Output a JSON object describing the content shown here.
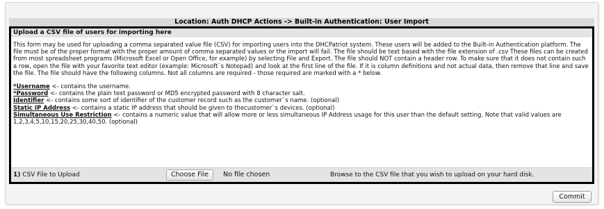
{
  "location_title": "Location: Auth DHCP Actions -> Built-in Authentication: User Import",
  "panel": {
    "header": "Upload a CSV file of users for importing here",
    "intro": "This form may be used for uploading a comma separated value file (CSV) for importing users into the DHCPatriot system. These users will be added to the Built-in Authentication platform. The file must be of the proper format with the proper amount of comma separated values or the import will fail. The file should be text based with the file extension of .csv These files can be created from most spreadsheet programs (Microsoft Excel or Open Office, for example) by selecting File and Export. The file should NOT contain a header row. To make sure that it does not contain such a row, open the file with your favorite text editor (example: Microsoft`s Notepad) and look at the first line of the file. If it is column definitions and not actual data, then remove that line and save the file. The file should have the following columns. Not all columns are required - those required are marked with a * below.",
    "fields": [
      {
        "name": "*Username",
        "desc": " <- contains the username."
      },
      {
        "name": "*Password",
        "desc": " <- contains the plain text password or MD5 encrypted password with 8 character salt."
      },
      {
        "name": "Identifier",
        "desc": " <- contains some sort of identifier of the customer record such as the customer`s name. (optional)"
      },
      {
        "name": "Static IP Address",
        "desc": " <- contains a static IP address that should be given to thecustomer`s devices. (optional)"
      },
      {
        "name": "Simultaneous Use Restriction",
        "desc": " <- contains a numeric value that will allow more or less simultaneous IP Address usage for this user than the default setting. Note that valid values are 1,2,3,4,5,10,15,20,25,30,40,50. (optional)"
      }
    ]
  },
  "upload": {
    "step_number": "1)",
    "label": " CSV File to Upload",
    "choose_button": "Choose File",
    "no_file_text": "No file chosen",
    "hint": "Browse to the CSV file that you wish to upload on your hard disk."
  },
  "commit_button": "Commit"
}
